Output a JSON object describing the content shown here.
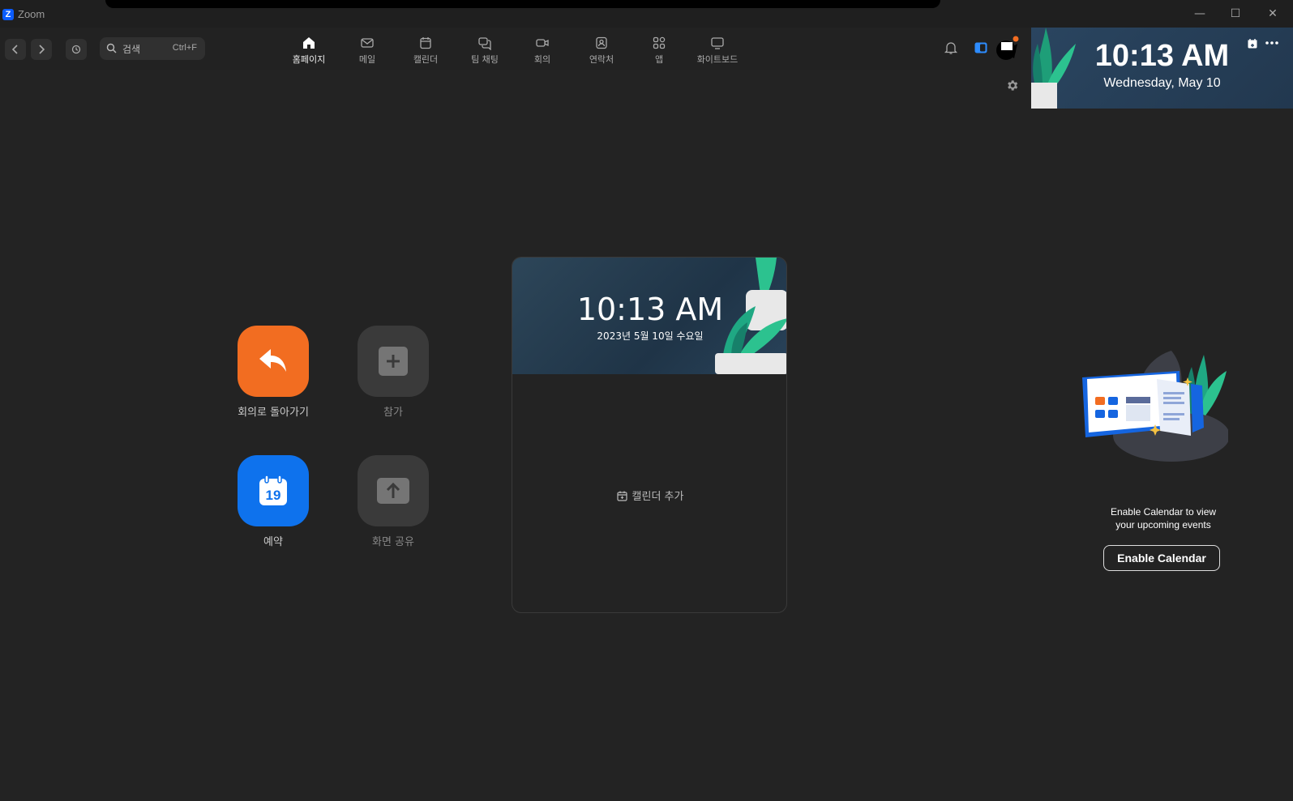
{
  "window": {
    "title": "Zoom",
    "logo_letter": "Z",
    "minimize": "—",
    "maximize": "☐",
    "close": "✕"
  },
  "toolbar": {
    "search_placeholder": "검색",
    "search_shortcut": "Ctrl+F",
    "tabs": [
      {
        "label": "홈페이지",
        "icon": "home-icon",
        "active": true
      },
      {
        "label": "메일",
        "icon": "mail-icon"
      },
      {
        "label": "캘린더",
        "icon": "calendar-icon"
      },
      {
        "label": "팀 채팅",
        "icon": "chat-icon"
      },
      {
        "label": "회의",
        "icon": "video-icon"
      },
      {
        "label": "연락처",
        "icon": "contacts-icon"
      },
      {
        "label": "앱",
        "icon": "apps-icon"
      },
      {
        "label": "화이트보드",
        "icon": "whiteboard-icon"
      }
    ]
  },
  "clock_widget": {
    "time": "10:13 AM",
    "date": "Wednesday, May 10"
  },
  "actions": [
    {
      "label": "회의로 돌아가기",
      "icon": "return-icon",
      "color": "#f26d21"
    },
    {
      "label": "참가",
      "icon": "plus-icon",
      "color": "#3a3a3a"
    },
    {
      "label": "예약",
      "icon": "calendar-19-icon",
      "color": "#0e72ed",
      "day": "19"
    },
    {
      "label": "화면 공유",
      "icon": "share-up-icon",
      "color": "#3a3a3a"
    }
  ],
  "card": {
    "time": "10:13 AM",
    "date": "2023년 5월 10일 수요일",
    "add_calendar": "캘린더 추가"
  },
  "right_panel": {
    "text_line1": "Enable Calendar to view",
    "text_line2": "your upcoming events",
    "button": "Enable Calendar"
  }
}
